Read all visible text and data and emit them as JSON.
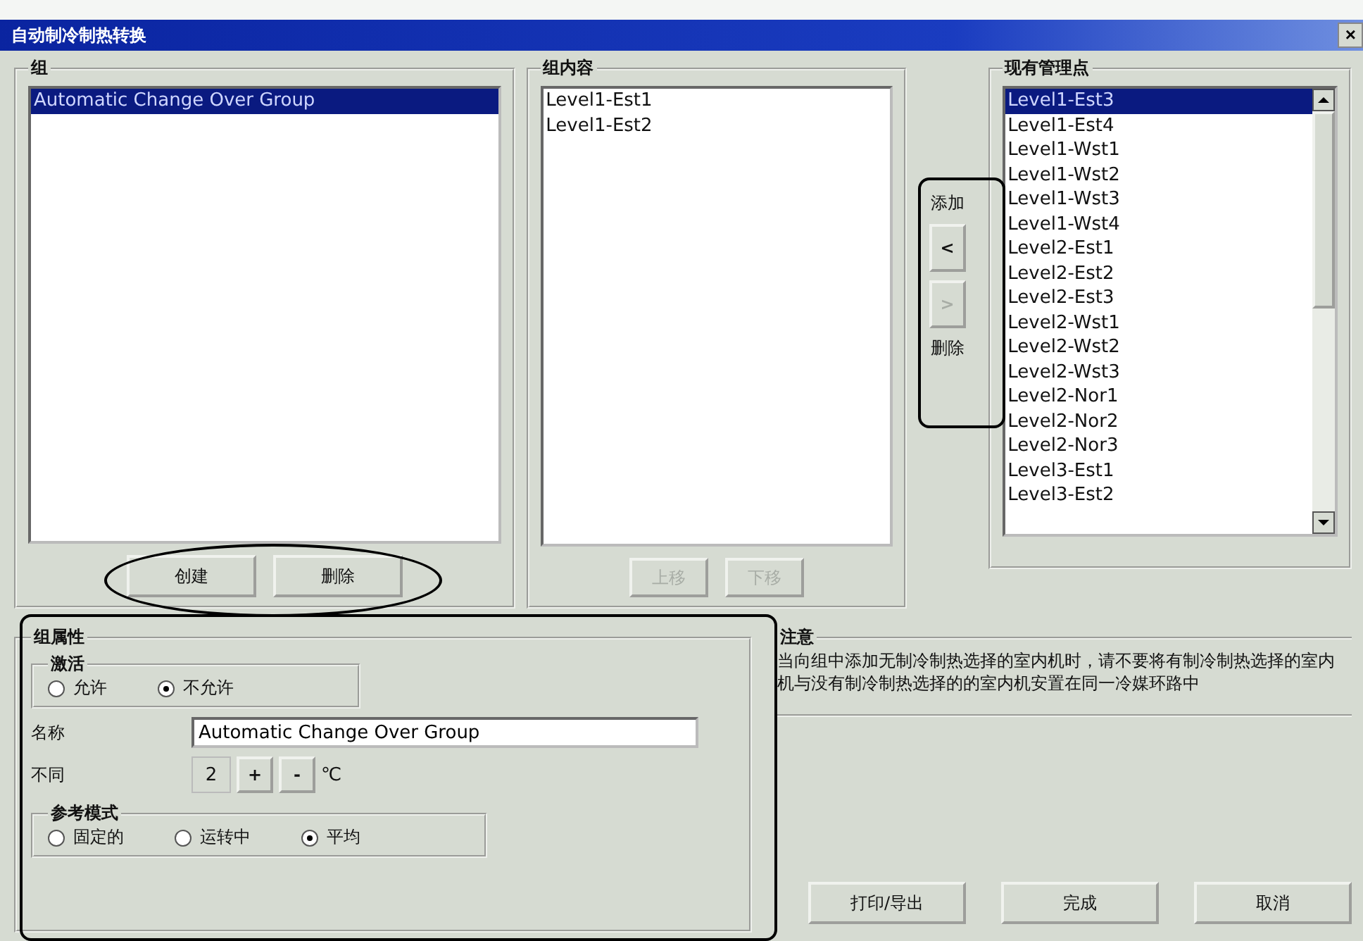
{
  "window": {
    "title": "自动制冷制热转换",
    "close_button": "×"
  },
  "group_panel": {
    "title": "组",
    "items": [
      {
        "label": "Automatic Change Over Group",
        "selected": true
      }
    ],
    "buttons": [
      {
        "label": "创建",
        "disabled": false
      },
      {
        "label": "删除",
        "disabled": false
      }
    ]
  },
  "content_panel": {
    "title": "组内容",
    "items": [
      {
        "label": "Level1-Est1",
        "selected": false
      },
      {
        "label": "Level1-Est2",
        "selected": false
      }
    ],
    "buttons": [
      {
        "label": "上移",
        "disabled": true
      },
      {
        "label": "下移",
        "disabled": true
      }
    ]
  },
  "transfer": {
    "add_label": "添加",
    "buttons": [
      {
        "label": "<",
        "disabled": false
      },
      {
        "label": ">",
        "disabled": true
      }
    ],
    "remove_label": "删除"
  },
  "available_panel": {
    "title": "现有管理点",
    "items": [
      {
        "label": "Level1-Est3",
        "selected": true
      },
      {
        "label": "Level1-Est4",
        "selected": false
      },
      {
        "label": "Level1-Wst1",
        "selected": false
      },
      {
        "label": "Level1-Wst2",
        "selected": false
      },
      {
        "label": "Level1-Wst3",
        "selected": false
      },
      {
        "label": "Level1-Wst4",
        "selected": false
      },
      {
        "label": "Level2-Est1",
        "selected": false
      },
      {
        "label": "Level2-Est2",
        "selected": false
      },
      {
        "label": "Level2-Est3",
        "selected": false
      },
      {
        "label": "Level2-Wst1",
        "selected": false
      },
      {
        "label": "Level2-Wst2",
        "selected": false
      },
      {
        "label": "Level2-Wst3",
        "selected": false
      },
      {
        "label": "Level2-Nor1",
        "selected": false
      },
      {
        "label": "Level2-Nor2",
        "selected": false
      },
      {
        "label": "Level2-Nor3",
        "selected": false
      },
      {
        "label": "Level3-Est1",
        "selected": false
      },
      {
        "label": "Level3-Est2",
        "selected": false
      }
    ]
  },
  "properties": {
    "title": "组属性",
    "activation": {
      "title": "激活",
      "options": [
        {
          "label": "允许",
          "selected": false
        },
        {
          "label": "不允许",
          "selected": true
        }
      ]
    },
    "name_label": "名称",
    "name_value": "Automatic Change Over Group",
    "diff_label": "不同",
    "diff_value": "2",
    "plus": "+",
    "minus": "-",
    "unit": "℃",
    "reference_mode": {
      "title": "参考模式",
      "options": [
        {
          "label": "固定的",
          "selected": false
        },
        {
          "label": "运转中",
          "selected": false
        },
        {
          "label": "平均",
          "selected": true
        }
      ]
    }
  },
  "note": {
    "title": "注意",
    "text": "当向组中添加无制冷制热选择的室内机时，请不要将有制冷制热选择的室内机与没有制冷制热选择的的室内机安置在同一冷媒环路中"
  },
  "footer_buttons": [
    {
      "label": "打印/导出"
    },
    {
      "label": "完成"
    },
    {
      "label": "取消"
    }
  ]
}
